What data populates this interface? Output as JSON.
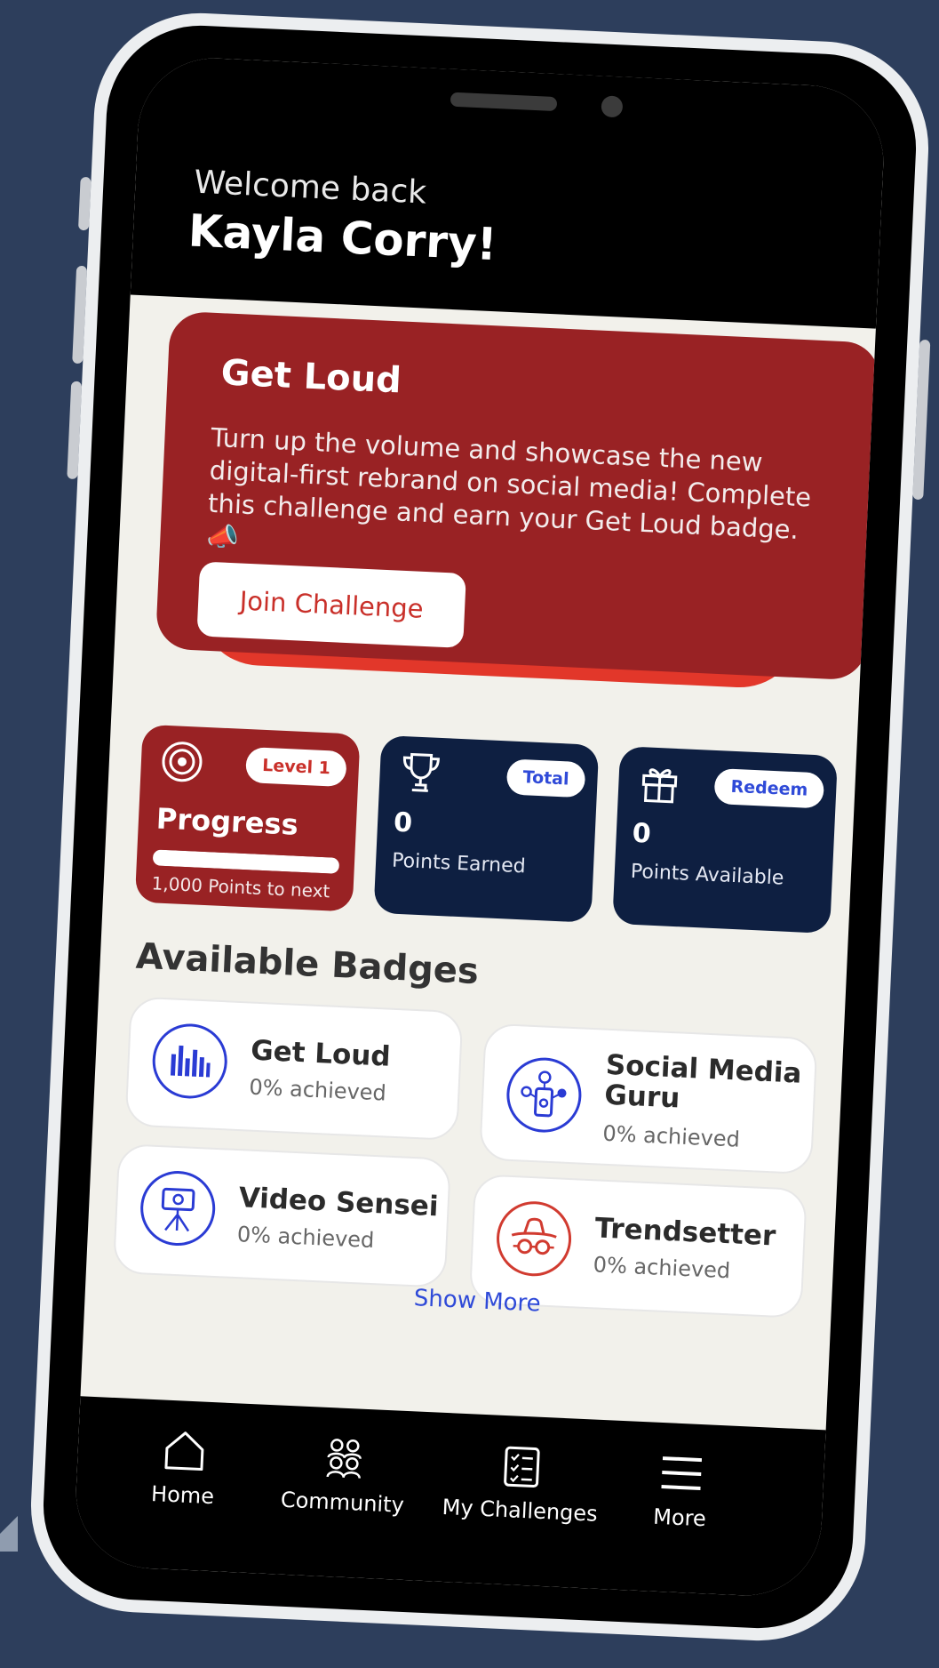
{
  "header": {
    "welcome": "Welcome back",
    "user_name": "Kayla Corry!"
  },
  "hero": {
    "title": "Get Loud",
    "description": "Turn up the volume and showcase the new digital-first rebrand on social media! Complete this challenge and earn your Get Loud badge. 📣",
    "button_label": "Join Challenge"
  },
  "stats": {
    "progress": {
      "icon": "target-icon",
      "pill": "Level 1",
      "label": "Progress",
      "bar_fraction": 1.0,
      "note": "1,000 Points to next"
    },
    "total": {
      "icon": "trophy-icon",
      "pill": "Total",
      "value": "0",
      "label": "Points Earned"
    },
    "redeem": {
      "icon": "gift-icon",
      "pill": "Redeem",
      "value": "0",
      "label": "Points Available"
    }
  },
  "badges": {
    "title": "Available Badges",
    "items": [
      {
        "name": "Get Loud",
        "progress": "0% achieved",
        "icon": "sound-bars-icon",
        "color": "#2a3bd4"
      },
      {
        "name": "Social Media Guru",
        "progress": "0% achieved",
        "icon": "social-phone-icon",
        "color": "#2a3bd4"
      },
      {
        "name": "Video Sensei",
        "progress": "0% achieved",
        "icon": "video-camera-tripod-icon",
        "color": "#2a3bd4"
      },
      {
        "name": "Trendsetter",
        "progress": "0% achieved",
        "icon": "hat-glasses-icon",
        "color": "#d13b30"
      }
    ],
    "show_more": "Show More"
  },
  "tabbar": {
    "items": [
      {
        "label": "Home",
        "icon": "home-icon"
      },
      {
        "label": "Community",
        "icon": "community-icon"
      },
      {
        "label": "My Challenges",
        "icon": "checklist-icon"
      },
      {
        "label": "More",
        "icon": "menu-icon"
      }
    ]
  },
  "colors": {
    "background": "#2d3e5c",
    "hero_red": "#992224",
    "accent_red": "#e2372a",
    "navy": "#0e1f41",
    "link_blue": "#2f4ad8"
  }
}
